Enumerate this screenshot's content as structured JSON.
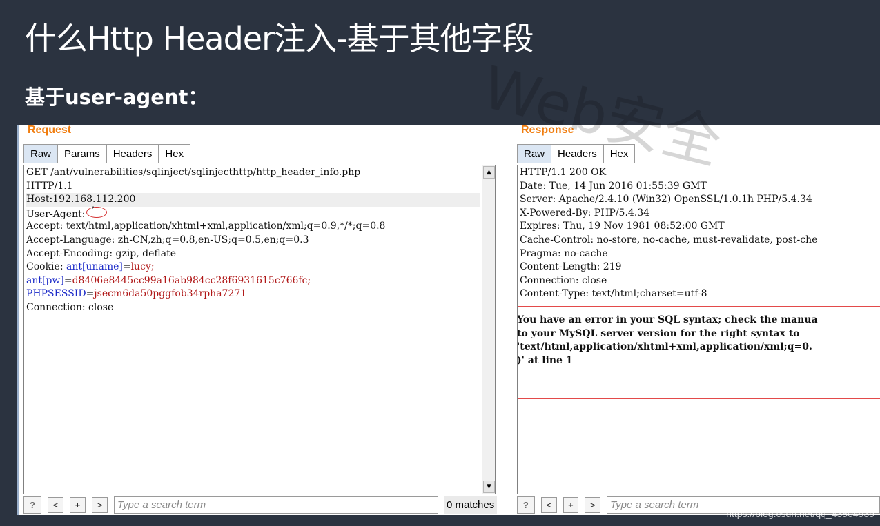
{
  "slide": {
    "title": "什么Http Header注入-基于其他字段",
    "subtitle": "基于user-agent：",
    "watermark": "Web安全",
    "footer_url": "https://blog.csdn.net/qq_43504939"
  },
  "request": {
    "label": "Request",
    "tabs": [
      "Raw",
      "Params",
      "Headers",
      "Hex"
    ],
    "active_tab": "Raw",
    "lines": {
      "l1": "GET /ant/vulnerabilities/sqlinject/sqlinjecthttp/http_header_info.php",
      "l2": "HTTP/1.1",
      "l3": "Host:192.168.112.200",
      "l4_key": "User-Agent:",
      "l4_val": "’",
      "l5": "Accept: text/html,application/xhtml+xml,application/xml;q=0.9,*/*;q=0.8",
      "l6": "Accept-Language: zh-CN,zh;q=0.8,en-US;q=0.5,en;q=0.3",
      "l7": "Accept-Encoding: gzip, deflate",
      "l8_key": "Cookie: ",
      "l8_name": "ant[uname]",
      "l8_eq": "=",
      "l8_val": "lucy;",
      "l9_name": "ant[pw]",
      "l9_eq": "=",
      "l9_val": "d8406e8445cc99a16ab984cc28f6931615c766fc;",
      "l10_name": "PHPSESSID",
      "l10_eq": "=",
      "l10_val": "jsecm6da50pggfob34rpha7271",
      "l11": "Connection: close"
    },
    "toolbar": {
      "help": "?",
      "prev": "<",
      "add": "+",
      "next": ">",
      "search_placeholder": "Type a search term",
      "matches": "0 matches"
    }
  },
  "response": {
    "label": "Response",
    "tabs": [
      "Raw",
      "Headers",
      "Hex"
    ],
    "active_tab": "Raw",
    "lines": {
      "l1": "HTTP/1.1 200 OK",
      "l2": "Date: Tue, 14 Jun 2016 01:55:39 GMT",
      "l3": "Server: Apache/2.4.10 (Win32) OpenSSL/1.0.1h PHP/5.4.34",
      "l4": "X-Powered-By: PHP/5.4.34",
      "l5": "Expires: Thu, 19 Nov 1981 08:52:00 GMT",
      "l6": "Cache-Control: no-store, no-cache, must-revalidate, post-che",
      "l7": "Pragma: no-cache",
      "l8": "Content-Length: 219",
      "l9": "Connection: close",
      "l10": "Content-Type: text/html;charset=utf-8"
    },
    "error": {
      "e1": "You have an error in your SQL syntax; check the manua",
      "e2": "to your MySQL server version for the right syntax to",
      "e3": "'text/html,application/xhtml+xml,application/xml;q=0.",
      "e4": ")' at line 1"
    },
    "toolbar": {
      "help": "?",
      "prev": "<",
      "add": "+",
      "next": ">",
      "search_placeholder": "Type a search term"
    }
  },
  "colors": {
    "background": "#2b3340",
    "pane_label": "#f07d0f",
    "cookie_name": "#1b2ac8",
    "cookie_value": "#b01818",
    "error_box": "#e34a4a"
  }
}
